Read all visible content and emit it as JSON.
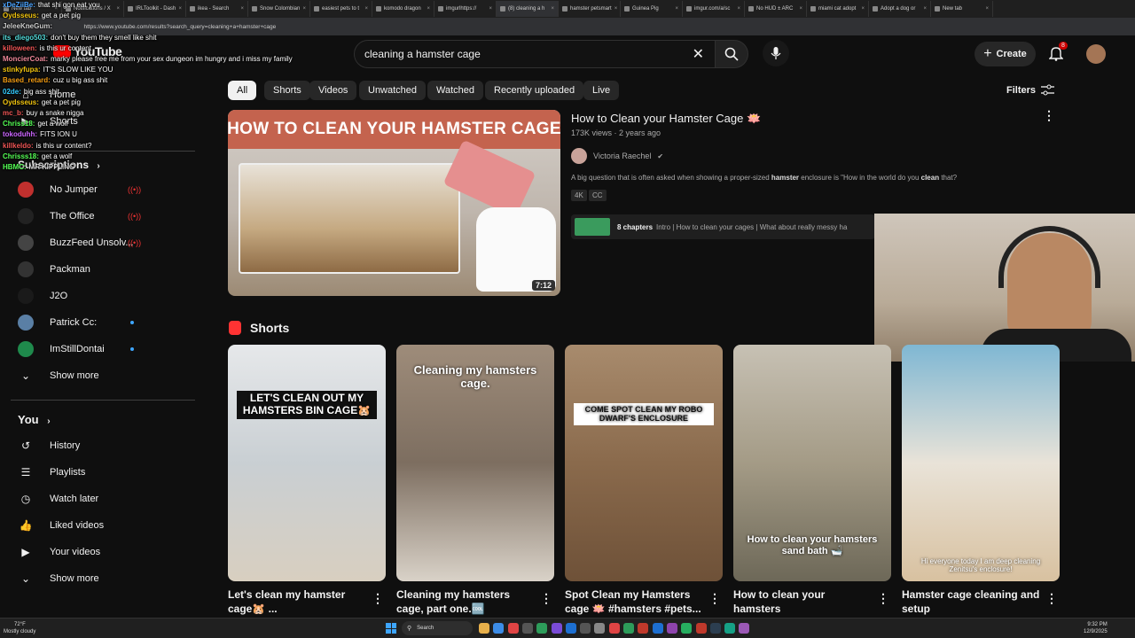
{
  "browser": {
    "tabs": [
      "New tab",
      "Notifications / X",
      "IRLToolkit - Dash",
      "ikea - Search",
      "Snow Colombian",
      "easiest pets to t",
      "komodo dragon",
      "imgurlhttps://",
      "(8) cleaning a h",
      "hamster petsmart",
      "Guinea Pig",
      "imgur.com/a/sc",
      "No HUD ± ARC",
      "miami cat adopt",
      "Adopt a dog or",
      "New tab"
    ],
    "url": "https://www.youtube.com/results?search_query=cleaning+a+hamster+cage"
  },
  "header": {
    "logo": "YouTube",
    "search_value": "cleaning a hamster cage",
    "create_label": "Create",
    "notif_count": "8"
  },
  "chips": [
    "All",
    "Shorts",
    "Videos",
    "Unwatched",
    "Watched",
    "Recently uploaded",
    "Live"
  ],
  "filters_label": "Filters",
  "sidebar": {
    "home": "Home",
    "shorts": "Shorts",
    "subscriptions": "Subscriptions",
    "subs": [
      {
        "name": "No Jumper",
        "status": "live"
      },
      {
        "name": "The Office",
        "status": "live"
      },
      {
        "name": "BuzzFeed Unsolv...",
        "status": "live"
      },
      {
        "name": "Packman",
        "status": ""
      },
      {
        "name": "J2O",
        "status": ""
      },
      {
        "name": "Patrick Cc:",
        "status": "new"
      },
      {
        "name": "ImStillDontai",
        "status": "new"
      }
    ],
    "show_more": "Show more",
    "you": "You",
    "you_items": [
      "History",
      "Playlists",
      "Watch later",
      "Liked videos",
      "Your videos"
    ],
    "show_more_2": "Show more"
  },
  "chat": [
    {
      "user": "xDeZiiBe:",
      "msg": "that shi gon eat you",
      "color": "#4aa3ff"
    },
    {
      "user": "Oydsseus:",
      "msg": "get a pet pig",
      "color": "#f1c40f"
    },
    {
      "user": "JeleeKneGum:",
      "msg": "",
      "color": "#ccc"
    },
    {
      "user": "its_diego503:",
      "msg": "don't buy them they smell like shit",
      "color": "#5dd"
    },
    {
      "user": "killoween:",
      "msg": "is this ur content",
      "color": "#e55"
    },
    {
      "user": "MoncierCoat:",
      "msg": "marky please free me from your sex dungeon im hungry and i miss my family",
      "color": "#e89"
    },
    {
      "user": "stinkyfupa:",
      "msg": "IT'S SLOW LIKE YOU",
      "color": "#f1c40f"
    },
    {
      "user": "Based_retard:",
      "msg": "cuz u big ass shit",
      "color": "#f39c12"
    },
    {
      "user": "02de:",
      "msg": "big ass shit",
      "color": "#3cf"
    },
    {
      "user": "Oydsseus:",
      "msg": "get a pet pig",
      "color": "#f1c40f"
    },
    {
      "user": "mc_b:",
      "msg": "buy a snake nigga",
      "color": "#e55"
    },
    {
      "user": "Chriss18:",
      "msg": "get a wolf",
      "color": "#5f5"
    },
    {
      "user": "tokoduhh:",
      "msg": "FITS ION U",
      "color": "#c6f"
    },
    {
      "user": "killkeldo:",
      "msg": "is this ur content?",
      "color": "#e55"
    },
    {
      "user": "Chrisss18:",
      "msg": "get a wolf",
      "color": "#5f5"
    },
    {
      "user": "HBMC:",
      "msg": "MR KIPPLING",
      "color": "#5f5"
    }
  ],
  "video": {
    "title": "How to Clean your Hamster Cage 🪷",
    "thumb_text": "HOW TO CLEAN YOUR HAMSTER CAGE",
    "duration": "7:12",
    "views": "173K views",
    "age": "2 years ago",
    "channel": "Victoria Raechel",
    "desc_pre": "A big question that is often asked when showing a proper-sized ",
    "desc_b1": "hamster",
    "desc_mid": " enclosure is \"How in the world do you ",
    "desc_b2": "clean",
    "desc_post": " that?",
    "badges": [
      "4K",
      "CC"
    ],
    "chapters_label": "8 chapters",
    "chapters_text": "Intro | How to clean your cages | What about really messy ha"
  },
  "shorts_heading": "Shorts",
  "shorts": [
    {
      "overlay": "LET'S CLEAN OUT MY HAMSTERS BIN CAGE🐹",
      "title1": "Let's clean my hamster",
      "title2": "cage🐹 ..."
    },
    {
      "overlay": "Cleaning my hamsters cage.",
      "title1": "Cleaning my hamsters",
      "title2": "cage, part one.🆒"
    },
    {
      "overlay": "COME SPOT CLEAN MY ROBO DWARF'S ENCLOSURE",
      "title1": "Spot Clean my Hamsters",
      "title2": "cage 🪷 #hamsters #pets..."
    },
    {
      "overlay": "How to clean your hamsters sand bath 🛁",
      "title1": "How to clean your hamsters",
      "title2": "sand bath"
    },
    {
      "overlay": "Hi everyone today I am deep cleaning Zenitsu's enclosure!",
      "title1": "Hamster cage cleaning and",
      "title2": "setup"
    }
  ],
  "taskbar": {
    "weather": "72°F",
    "weather_desc": "Mostly cloudy",
    "search": "Search",
    "time": "9:32 PM",
    "date": "12/9/2025"
  }
}
